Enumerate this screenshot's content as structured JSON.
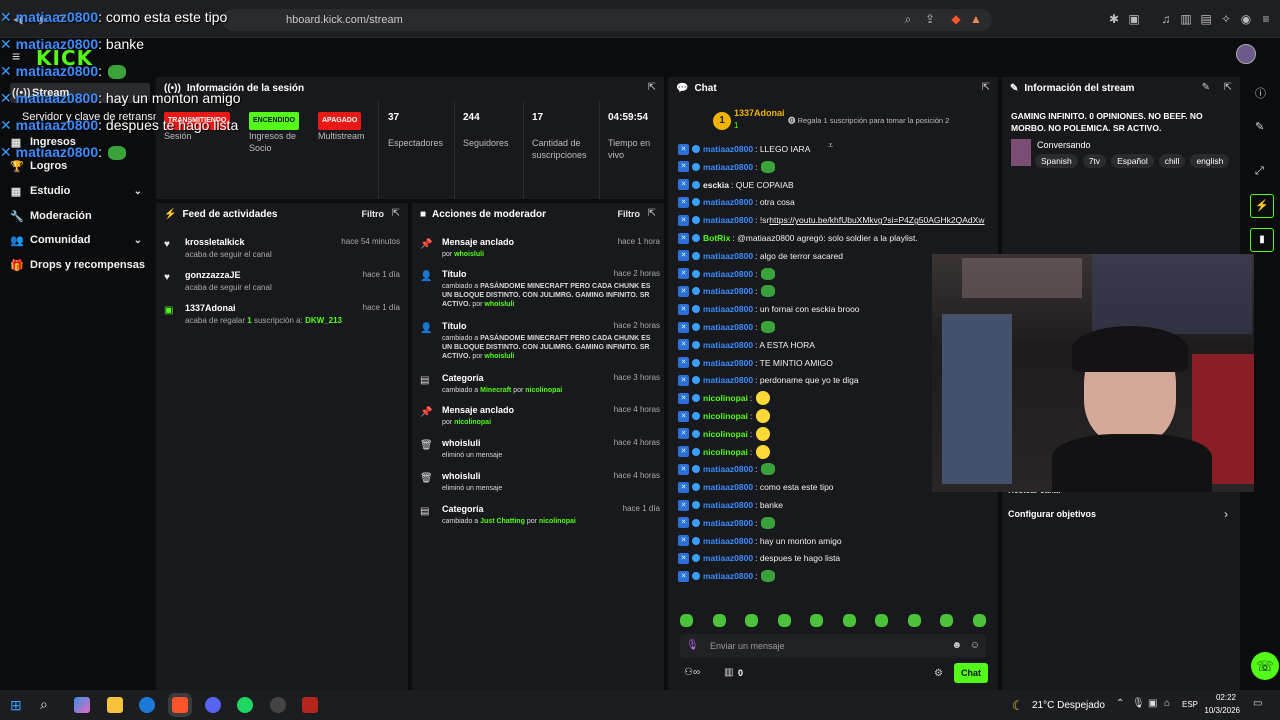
{
  "browser": {
    "url": "hboard.kick.com/stream"
  },
  "brand": {
    "logo": "KICK"
  },
  "overlay": [
    {
      "user": "matiaaz0800",
      "msg": ": como esta este tipo"
    },
    {
      "user": "matiaaz0800",
      "msg": ": banke"
    },
    {
      "user": "matiaaz0800",
      "msg": ":"
    },
    {
      "user": "matiaaz0800",
      "msg": ": hay un monton amigo"
    },
    {
      "user": "matiaaz0800",
      "msg": ": despues te hago lista"
    },
    {
      "user": "matiaaz0800",
      "msg": ":"
    }
  ],
  "sidebar": {
    "items": [
      {
        "label": "Stream",
        "icon": "broadcast-icon"
      },
      {
        "label": "Servidor y clave de retransm",
        "icon": ""
      },
      {
        "label": "Ingresos",
        "icon": "money-icon"
      },
      {
        "label": "Logros",
        "icon": "trophy-icon"
      },
      {
        "label": "Estudio",
        "icon": "grid-icon"
      },
      {
        "label": "Moderación",
        "icon": "wrench-icon"
      },
      {
        "label": "Comunidad",
        "icon": "people-icon"
      },
      {
        "label": "Drops y recompensas",
        "icon": "gift-icon"
      }
    ]
  },
  "session": {
    "title": "Información de la sesión",
    "stats": [
      {
        "badge": "TRANSMITIENDO",
        "label": "Sesión"
      },
      {
        "badge": "ENCENDIDO",
        "label": "Ingresos de Socio"
      },
      {
        "badge": "APAGADO",
        "label": "Multistream"
      },
      {
        "value": "37",
        "label": "Espectadores"
      },
      {
        "value": "244",
        "label": "Seguidores"
      },
      {
        "value": "17",
        "label": "Cantidad de suscripciones"
      },
      {
        "value": "04:59:54",
        "label": "Tiempo en vivo"
      }
    ]
  },
  "feed": {
    "title": "Feed de actividades",
    "filter": "Filtro",
    "items": [
      {
        "name": "krossletalkick",
        "sub": "acaba de seguir el canal",
        "time": "hace 54 minutos"
      },
      {
        "name": "gonzzazzaJE",
        "sub": "acaba de seguir el canal",
        "time": "hace 1 día"
      },
      {
        "name": "1337Adonai",
        "sub_pre": "acaba de regalar ",
        "sub_num": "1",
        "sub_mid": " suscripción a: ",
        "sub_user": "DKW_213",
        "time": "hace 1 día"
      }
    ]
  },
  "mod": {
    "title": "Acciones de moderador",
    "filter": "Filtro",
    "items": [
      {
        "name": "Mensaje anclado",
        "pre": "por ",
        "user": "whoisluli",
        "time": "hace 1 hora"
      },
      {
        "name": "Título",
        "pre": "cambiado a ",
        "body": "PASÁNDOME MINECRAFT PERO CADA CHUNK ES UN BLOQUE DISTINTO. CON JULIMRG. GAMING INFINITO. SR ACTIVO.",
        "mid": " por ",
        "user": "whoisluli",
        "time": "hace 2 horas"
      },
      {
        "name": "Título",
        "pre": "cambiado a ",
        "body": "PASÁNDOME MINECRAFT PERO CADA CHUNK ES UN BLOQUE DISTINTO. CON JULIMRG. GAMING INFINITO. SR ACTIVO.",
        "mid": " por ",
        "user": "whoisluli",
        "time": "hace 2 horas"
      },
      {
        "name": "Categoría",
        "pre": "cambiado a ",
        "body": "Minecraft",
        "mid": " por ",
        "user": "nicolinopai",
        "time": "hace 3 horas"
      },
      {
        "name": "Mensaje anclado",
        "pre": "por ",
        "user": "nicolinopai",
        "time": "hace 4 horas"
      },
      {
        "name": "whoisluli",
        "pre": "eliminó un mensaje",
        "time": "hace 4 horas"
      },
      {
        "name": "whoisluli",
        "pre": "eliminó un mensaje",
        "time": "hace 4 horas"
      },
      {
        "name": "Categoría",
        "pre": "cambiado a ",
        "body": "Just Chatting",
        "mid": " por ",
        "user": "nicolinopai",
        "time": "hace 1 día"
      }
    ]
  },
  "chat": {
    "title": "Chat",
    "top_user": "1337Adonai",
    "top_count": "1",
    "top_prompt": "Regala 1 suscripción para tomar la posición 2",
    "lines": [
      {
        "user": "matiaaz0800",
        "msg": ": LLEGO IARA"
      },
      {
        "user": "matiaaz0800",
        "msg": ":"
      },
      {
        "user": "esckia",
        "msg": ": QUE COPAIAB",
        "cls": "w"
      },
      {
        "user": "matiaaz0800",
        "msg": ": otra cosa"
      },
      {
        "user": "matiaaz0800",
        "msg": ": !sr ",
        "link": "https://youtu.be/khfUbuXMkvg?si=P4Zg50AGHk2QAdXw"
      },
      {
        "user": "BotRix",
        "msg": ": @matiaaz0800 agregó: solo soldier a la playlist.",
        "cls": "g"
      },
      {
        "user": "matiaaz0800",
        "msg": ": algo de terror sacared"
      },
      {
        "user": "matiaaz0800",
        "msg": ":"
      },
      {
        "user": "matiaaz0800",
        "msg": ":"
      },
      {
        "user": "matiaaz0800",
        "msg": ": un fornai con esckia brooo"
      },
      {
        "user": "matiaaz0800",
        "msg": ":"
      },
      {
        "user": "matiaaz0800",
        "msg": ": A ESTA HORA"
      },
      {
        "user": "matiaaz0800",
        "msg": ": TE MINTIO AMIGO"
      },
      {
        "user": "matiaaz0800",
        "msg": ": perdoname que yo te diga"
      },
      {
        "user": "nicolinopai",
        "msg": ":",
        "cls": "g"
      },
      {
        "user": "nicolinopai",
        "msg": ":",
        "cls": "g"
      },
      {
        "user": "nicolinopai",
        "msg": ":",
        "cls": "g"
      },
      {
        "user": "nicolinopai",
        "msg": ":",
        "cls": "g"
      },
      {
        "user": "matiaaz0800",
        "msg": ":"
      },
      {
        "user": "matiaaz0800",
        "msg": ": como esta este tipo"
      },
      {
        "user": "matiaaz0800",
        "msg": ": banke"
      },
      {
        "user": "matiaaz0800",
        "msg": ":"
      },
      {
        "user": "matiaaz0800",
        "msg": ": hay un monton amigo"
      },
      {
        "user": "matiaaz0800",
        "msg": ": despues te hago lista"
      },
      {
        "user": "matiaaz0800",
        "msg": ":"
      }
    ],
    "input_placeholder": "Enviar un mensaje",
    "points": "0",
    "send_label": "Chat"
  },
  "stream_info": {
    "title": "Información del stream",
    "stream_title": "GAMING INFINITO. 0 OPINIONES. NO BEEF. NO MORBO. NO POLEMICA. SR ACTIVO.",
    "category": "Conversando",
    "tags": [
      "Spanish",
      "7tv",
      "Español",
      "chill",
      "english"
    ],
    "host_label": "Hostear canal",
    "goals_label": "Configurar objetivos"
  },
  "taskbar": {
    "weather": "21°C  Despejado",
    "lang": "ESP",
    "time": "02:22",
    "date": "10/3/2026"
  },
  "colors": {
    "accent": "#53fc18",
    "live": "#e91916",
    "link": "#3c8cff"
  }
}
